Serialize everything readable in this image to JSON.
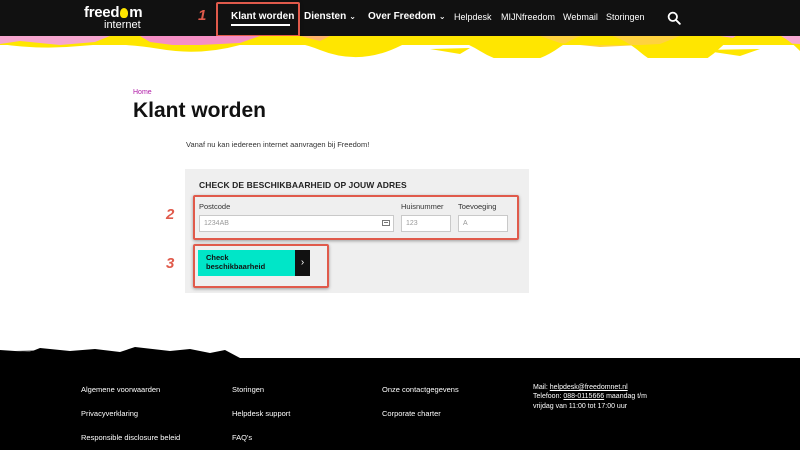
{
  "logo": {
    "line1_a": "freed",
    "line1_b": "m",
    "line2": "internet"
  },
  "nav": {
    "items": [
      {
        "label": "Klant worden",
        "dropdown": false
      },
      {
        "label": "Diensten",
        "dropdown": true
      },
      {
        "label": "Over Freedom",
        "dropdown": true
      },
      {
        "label": "Helpdesk",
        "dropdown": false
      },
      {
        "label": "MIJNfreedom",
        "dropdown": false
      },
      {
        "label": "Webmail",
        "dropdown": false
      },
      {
        "label": "Storingen",
        "dropdown": false
      }
    ],
    "chevron": "⌄"
  },
  "annotations": {
    "n1": "1",
    "n2": "2",
    "n3": "3",
    "color": "#e05a4b"
  },
  "breadcrumb": "Home",
  "page_title": "Klant worden",
  "intro": "Vanaf nu kan iedereen internet aanvragen bij Freedom!",
  "form": {
    "heading": "CHECK DE BESCHIKBAARHEID OP JOUW ADRES",
    "postcode": {
      "label": "Postcode",
      "placeholder": "1234AB"
    },
    "huisnummer": {
      "label": "Huisnummer",
      "placeholder": "123"
    },
    "toevoeging": {
      "label": "Toevoeging",
      "placeholder": "A"
    },
    "submit": {
      "line1": "Check",
      "line2": "beschikbaarheid",
      "arrow": "›"
    }
  },
  "footer": {
    "col1": [
      "Algemene voorwaarden",
      "Privacyverklaring",
      "Responsible disclosure beleid"
    ],
    "col2": [
      "Storingen",
      "Helpdesk support",
      "FAQ's"
    ],
    "col3": [
      "Onze contactgegevens",
      "Corporate charter"
    ],
    "contact": {
      "mail_label": "Mail:",
      "mail": "helpdesk@freedomnet.nl",
      "phone_label": "Telefoon:",
      "phone": "088-0115666",
      "hours_a": "maandag t/m",
      "hours_b": "vrijdag van 11:00 tot 17:00 uur"
    }
  },
  "colors": {
    "accent": "#00e6c8",
    "nav_bg": "#111111",
    "breadcrumb": "#b01aa7",
    "brand_yellow": "#ffe600"
  }
}
